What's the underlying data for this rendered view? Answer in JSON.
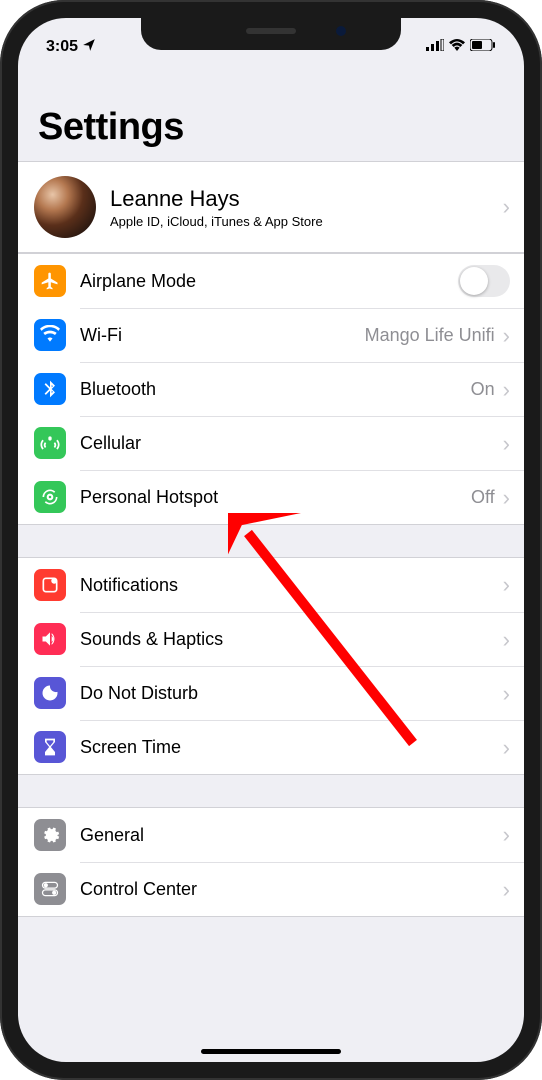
{
  "status": {
    "time": "3:05",
    "location_icon": "location-arrow",
    "signal_icon": "cellular-signal",
    "wifi_icon": "wifi",
    "battery_icon": "battery"
  },
  "page_title": "Settings",
  "account": {
    "name": "Leanne Hays",
    "subtitle": "Apple ID, iCloud, iTunes & App Store"
  },
  "groups": [
    {
      "items": [
        {
          "key": "airplane",
          "label": "Airplane Mode",
          "icon": "airplane-icon",
          "color": "c-orange",
          "control": "toggle",
          "toggle_on": false
        },
        {
          "key": "wifi",
          "label": "Wi-Fi",
          "icon": "wifi-icon",
          "color": "c-blue",
          "control": "disclosure",
          "value": "Mango Life Unifi"
        },
        {
          "key": "bluetooth",
          "label": "Bluetooth",
          "icon": "bluetooth-icon",
          "color": "c-blue",
          "control": "disclosure",
          "value": "On"
        },
        {
          "key": "cellular",
          "label": "Cellular",
          "icon": "cellular-icon",
          "color": "c-green",
          "control": "disclosure",
          "value": ""
        },
        {
          "key": "hotspot",
          "label": "Personal Hotspot",
          "icon": "hotspot-icon",
          "color": "c-green",
          "control": "disclosure",
          "value": "Off"
        }
      ]
    },
    {
      "items": [
        {
          "key": "notifications",
          "label": "Notifications",
          "icon": "notifications-icon",
          "color": "c-red",
          "control": "disclosure",
          "value": ""
        },
        {
          "key": "sounds",
          "label": "Sounds & Haptics",
          "icon": "sounds-icon",
          "color": "c-pink",
          "control": "disclosure",
          "value": ""
        },
        {
          "key": "dnd",
          "label": "Do Not Disturb",
          "icon": "moon-icon",
          "color": "c-indigo",
          "control": "disclosure",
          "value": ""
        },
        {
          "key": "screentime",
          "label": "Screen Time",
          "icon": "hourglass-icon",
          "color": "c-indigo",
          "control": "disclosure",
          "value": ""
        }
      ]
    },
    {
      "items": [
        {
          "key": "general",
          "label": "General",
          "icon": "gear-icon",
          "color": "c-gray",
          "control": "disclosure",
          "value": ""
        },
        {
          "key": "controlcenter",
          "label": "Control Center",
          "icon": "switches-icon",
          "color": "c-gray",
          "control": "disclosure",
          "value": ""
        }
      ]
    }
  ],
  "annotation": {
    "type": "arrow",
    "target": "bluetooth",
    "color": "#ff0000"
  }
}
